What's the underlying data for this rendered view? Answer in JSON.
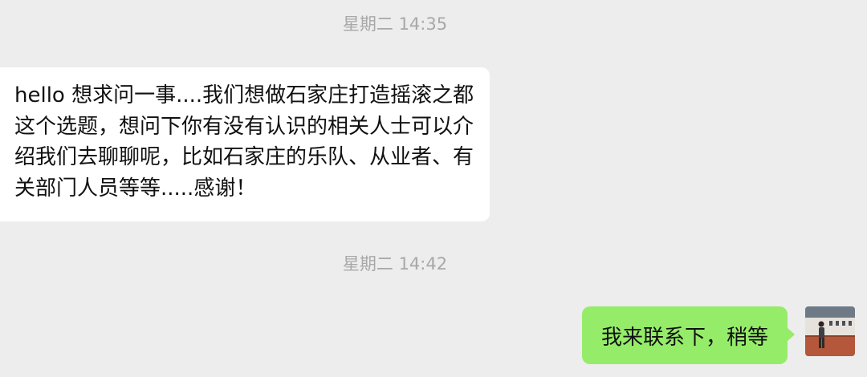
{
  "chat": {
    "timestamp_1": "星期二 14:35",
    "incoming_message": "hello 想求问一事....我们想做石家庄打造摇滚之都这个选题，想问下你有没有认识的相关人士可以介绍我们去聊聊呢，比如石家庄的乐队、从业者、有关部门人员等等.....感谢！",
    "timestamp_2": "星期二 14:42",
    "outgoing_message": "我来联系下，稍等"
  },
  "colors": {
    "background": "#ededed",
    "incoming_bubble": "#ffffff",
    "outgoing_bubble": "#95ec69",
    "timestamp_text": "#a8a8a8"
  },
  "avatar": {
    "icon": "user-photo-avatar"
  }
}
